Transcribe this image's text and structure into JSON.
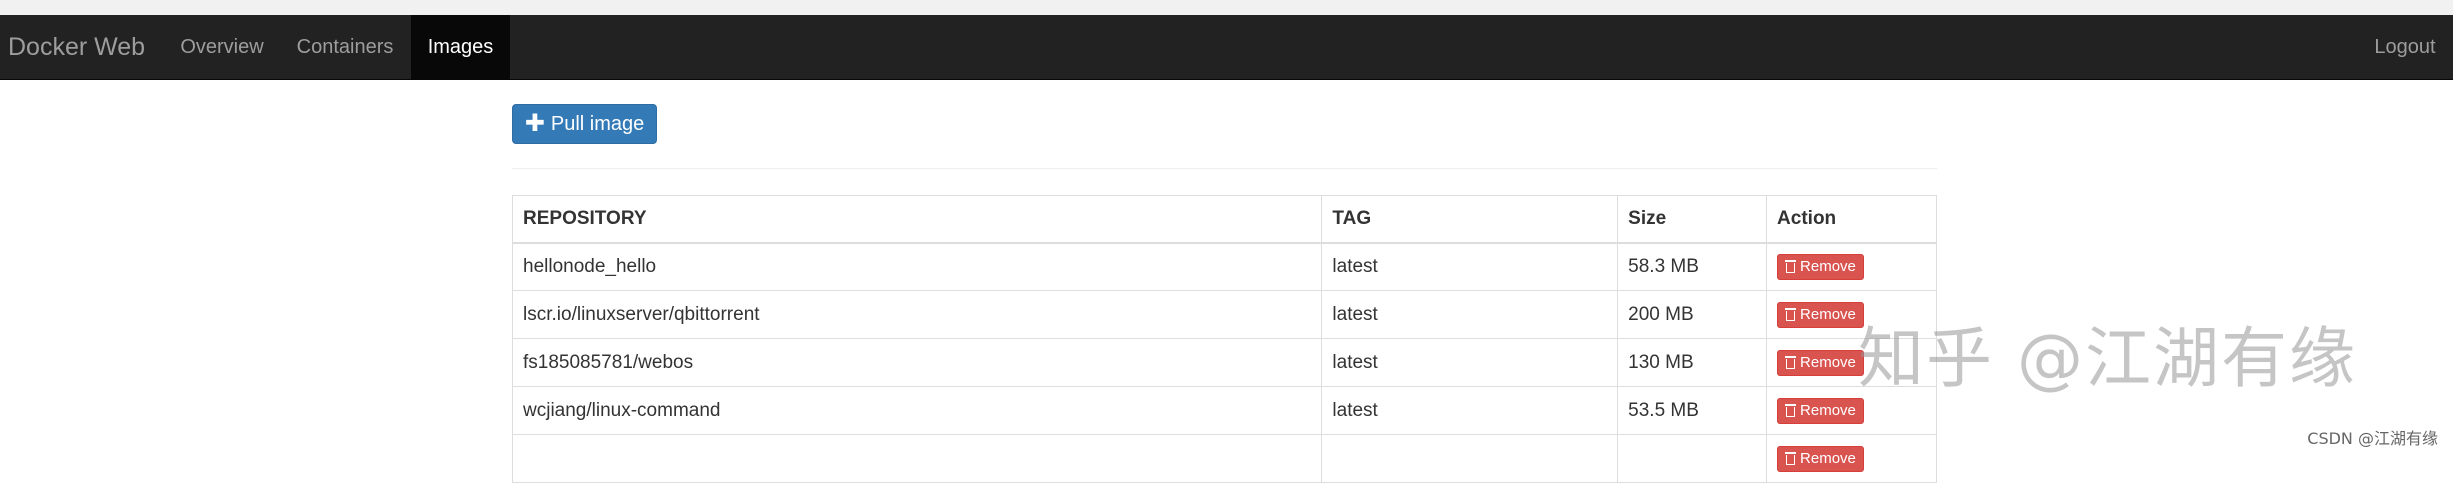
{
  "navbar": {
    "brand": "Docker Web",
    "items": [
      {
        "label": "Overview"
      },
      {
        "label": "Containers"
      },
      {
        "label": "Images"
      }
    ],
    "logout": "Logout"
  },
  "toolbar": {
    "pull_label": "Pull image",
    "pull_icon": "plus-icon"
  },
  "table": {
    "headers": [
      "REPOSITORY",
      "TAG",
      "Size",
      "Action"
    ],
    "remove_label": "Remove",
    "rows": [
      {
        "repository": "hellonode_hello",
        "tag": "latest",
        "size": "58.3 MB"
      },
      {
        "repository": "lscr.io/linuxserver/qbittorrent",
        "tag": "latest",
        "size": "200 MB"
      },
      {
        "repository": "fs185085781/webos",
        "tag": "latest",
        "size": "130 MB"
      },
      {
        "repository": "wcjiang/linux-command",
        "tag": "latest",
        "size": "53.5 MB"
      },
      {
        "repository": "",
        "tag": "",
        "size": ""
      }
    ]
  },
  "watermark": "知乎 @江湖有缘",
  "footer_credit": "CSDN @江湖有缘",
  "colors": {
    "navbar_bg": "#222222",
    "primary": "#337ab7",
    "danger": "#d9534f"
  }
}
